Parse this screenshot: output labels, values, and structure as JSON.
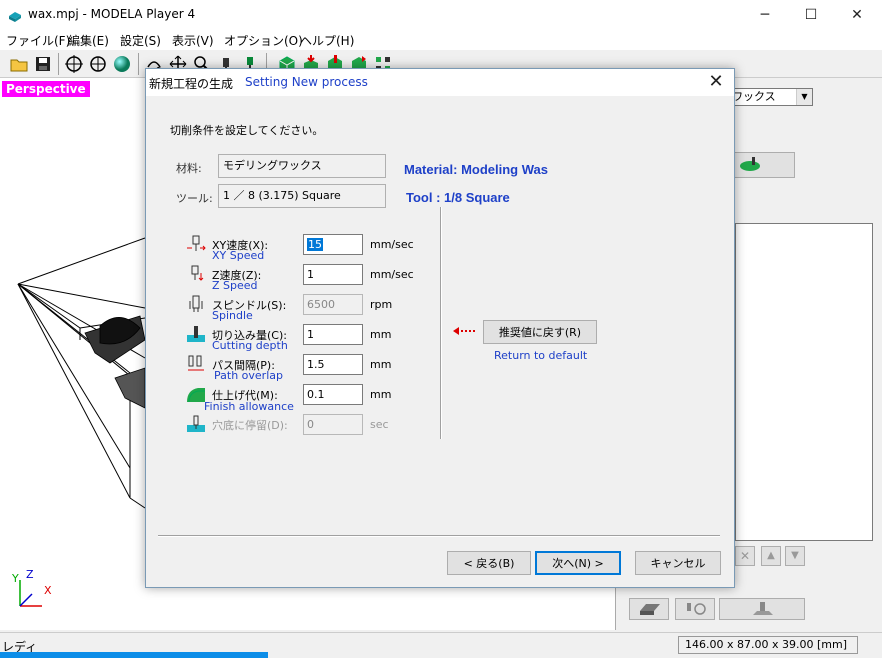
{
  "window": {
    "title": "wax.mpj - MODELA Player 4",
    "controls": {
      "minimize": "─",
      "maximize": "☐",
      "close": "✕"
    }
  },
  "menu": [
    "ファイル(F)",
    "編集(E)",
    "設定(S)",
    "表示(V)",
    "オプション(O)",
    "ヘルプ(H)"
  ],
  "viewport": {
    "label": "Perspective",
    "axis_y": "Y",
    "axis_z": "Z",
    "axis_x": "X"
  },
  "right_panel": {
    "material_select": "ワックス"
  },
  "status": {
    "left": "レディ",
    "dimensions": "146.00 x 87.00 x 39.00 [mm]"
  },
  "dialog": {
    "title_jp": "新規工程の生成",
    "title_en": "Setting New process",
    "instruction": "切削条件を設定してください。",
    "material_label": "材料:",
    "material_value": "モデリングワックス",
    "material_en": "Material: Modeling Was",
    "tool_label": "ツール:",
    "tool_value": "1 ／ 8 (3.175) Square",
    "tool_en": "Tool : 1/8 Square",
    "params": [
      {
        "jp": "XY速度(X):",
        "en": "XY Speed",
        "value": "15",
        "unit": "mm/sec",
        "enabled": true
      },
      {
        "jp": "Z速度(Z):",
        "en": "Z Speed",
        "value": "1",
        "unit": "mm/sec",
        "enabled": true
      },
      {
        "jp": "スピンドル(S):",
        "en": "Spindle",
        "value": "6500",
        "unit": "rpm",
        "enabled": false
      },
      {
        "jp": "切り込み量(C):",
        "en": "Cutting depth",
        "value": "1",
        "unit": "mm",
        "enabled": true
      },
      {
        "jp": "パス間隔(P):",
        "en": "Path overlap",
        "value": "1.5",
        "unit": "mm",
        "enabled": true
      },
      {
        "jp": "仕上げ代(M):",
        "en": "Finish allowance",
        "value": "0.1",
        "unit": "mm",
        "enabled": true
      },
      {
        "jp": "穴底に停留(D):",
        "en": "",
        "value": "0",
        "unit": "sec",
        "enabled": false
      }
    ],
    "default_button": "推奨値に戻す(R)",
    "default_en": "Return to default",
    "back_button": "< 戻る(B)",
    "next_button": "次へ(N) >",
    "cancel_button": "キャンセル"
  },
  "colors": {
    "accent_blue": "#1e40c8",
    "perspective_bg": "#ff00ff",
    "selection": "#0078d7"
  }
}
